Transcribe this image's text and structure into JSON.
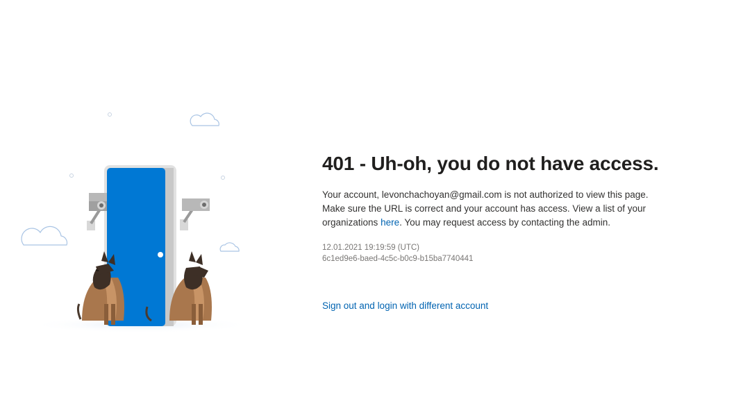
{
  "error": {
    "title": "401 - Uh-oh, you do not have access.",
    "message_part1": "Your account, levonchachoyan@gmail.com is not authorized to view this page. Make sure the URL is correct and your account has access. View a list of your organizations ",
    "here_link": "here",
    "message_part2": ". You may request access by contacting the admin.",
    "timestamp": "12.01.2021 19:19:59 (UTC)",
    "activity_id": "6c1ed9e6-baed-4c5c-b0c9-b15ba7740441"
  },
  "actions": {
    "signout_label": "Sign out and login with different account"
  },
  "colors": {
    "door_blue": "#0078d4",
    "link_blue": "#0063b1",
    "title_text": "#201f1e"
  },
  "illustration": {
    "icons": [
      "cloud-icon",
      "door-icon",
      "security-camera-icon",
      "dog-icon"
    ]
  }
}
